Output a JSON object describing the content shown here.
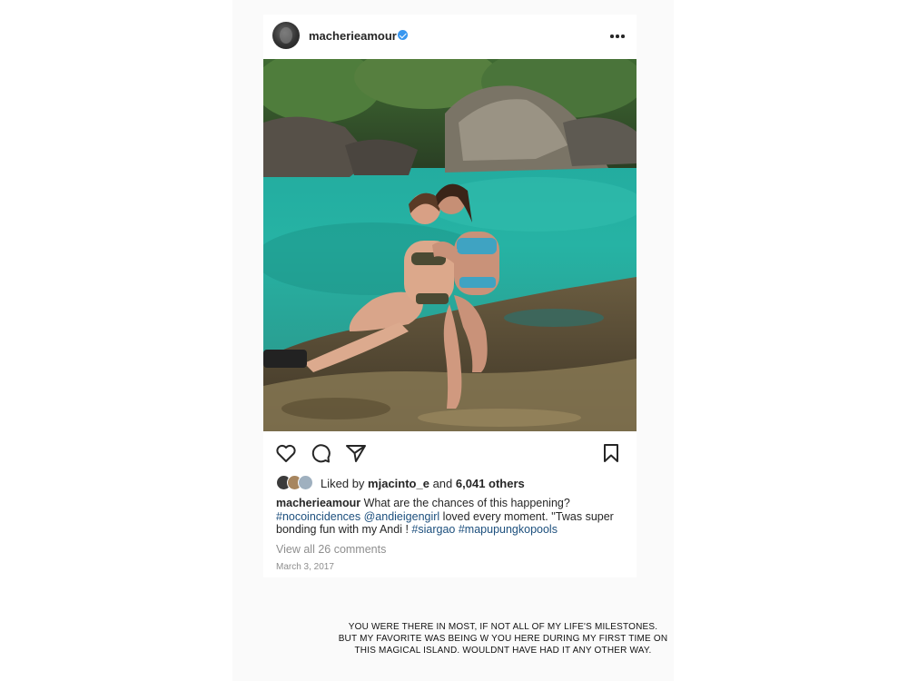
{
  "post": {
    "username": "macherieamour",
    "verified": true,
    "photo_alt": "Two women in swimsuits sitting on a rock beside a turquoise lagoon",
    "liked_by_prefix": "Liked by ",
    "liked_by_user": "mjacinto_e",
    "liked_by_join": " and ",
    "liked_by_others": "6,041 others",
    "caption": {
      "user": "macherieamour",
      "text_1": " What are the chances of this happening? ",
      "tag_1": "#nocoincidences",
      "space_1": " ",
      "mention": "@andieigengirl",
      "text_2": "  loved every moment. ''Twas super bonding fun with my Andi ! ",
      "tag_2": "#siargao",
      "space_2": " ",
      "tag_3": "#mapupungkopools"
    },
    "view_comments": "View all 26 comments",
    "date": "March 3, 2017"
  },
  "icons": {
    "verified": "verified-badge-icon",
    "more": "more-options-icon",
    "like": "heart-icon",
    "comment": "comment-bubble-icon",
    "share": "paper-plane-icon",
    "save": "bookmark-icon"
  },
  "colors": {
    "link": "#1c4f7d",
    "verified": "#3897f0",
    "muted": "#8e8e8e",
    "text": "#262626"
  },
  "note": {
    "line_1": "YOU WERE THERE IN MOST, IF NOT ALL OF MY LIFE'S MILESTONES.",
    "line_2": "BUT MY FAVORITE WAS BEING W YOU HERE DURING MY FIRST TIME ON",
    "line_3": "THIS MAGICAL ISLAND. WOULDNT HAVE HAD IT ANY OTHER WAY."
  }
}
